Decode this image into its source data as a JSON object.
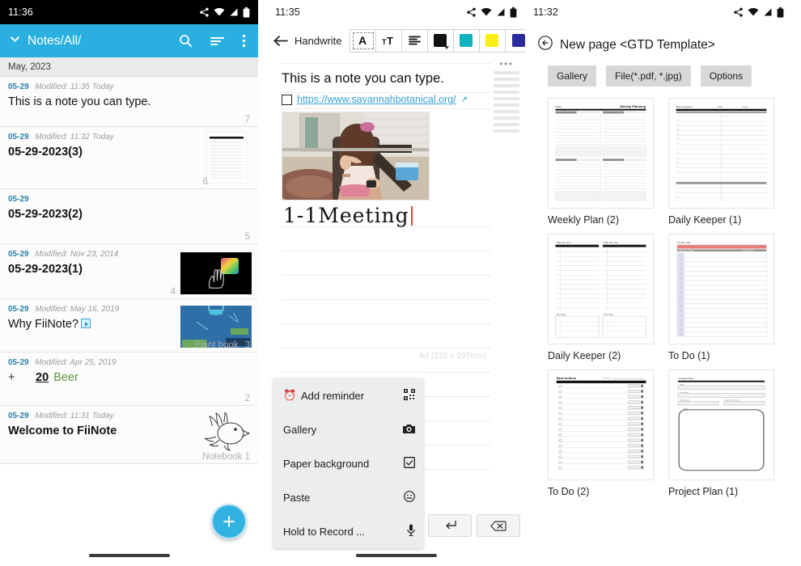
{
  "panel1": {
    "status": {
      "time": "11:36",
      "icons": [
        "share-icon",
        "wifi-icon",
        "signal-icon",
        "battery-icon"
      ]
    },
    "appbar": {
      "title": "Notes/All/",
      "chevron": "chevron-down-icon",
      "icons": [
        "search-icon",
        "sort-icon",
        "overflow-menu-icon"
      ]
    },
    "month_header": "May, 2023",
    "notes": [
      {
        "date": "05-29",
        "modified": "Modified: 11:35 Today",
        "title": "This is a note you can type.",
        "bold": false,
        "count": "7",
        "notebook": "",
        "thumb": "none"
      },
      {
        "date": "05-29",
        "modified": "Modified: 11:32 Today",
        "title": "05-29-2023(3)",
        "bold": true,
        "count": "6",
        "notebook": "",
        "thumb": "planner"
      },
      {
        "date": "05-29",
        "modified": "",
        "title": "05-29-2023(2)",
        "bold": true,
        "count": "5",
        "notebook": "",
        "thumb": "none"
      },
      {
        "date": "05-29",
        "modified": "Modified: Nov 23, 2014",
        "title": "05-29-2023(1)",
        "bold": true,
        "count": "4",
        "notebook": "",
        "thumb": "dark-hand"
      },
      {
        "date": "05-29",
        "modified": "Modified: May 16, 2019",
        "title": "Why FiiNote?",
        "bold": false,
        "count": "3",
        "notebook": "Paint book",
        "thumb": "blue-diagram",
        "badge": "video-icon"
      },
      {
        "date": "05-29",
        "modified": "Modified: Apr 25, 2019",
        "title": "",
        "bold": false,
        "count": "2",
        "notebook": "",
        "thumb": "none",
        "beer": {
          "plus": "+",
          "qty": "20",
          "name": "Beer"
        }
      },
      {
        "date": "05-29",
        "modified": "Modified: 11:31 Today",
        "title": "Welcome to FiiNote",
        "bold": true,
        "count": "",
        "notebook": "Notebook 1",
        "thumb": "bird"
      }
    ],
    "fab_label": "+"
  },
  "panel2": {
    "status": {
      "time": "11:35",
      "icons": [
        "share-icon",
        "wifi-icon",
        "signal-icon",
        "battery-icon"
      ]
    },
    "toolbar": {
      "back": "back-arrow-icon",
      "mode_label": "Handwrite",
      "buttons": [
        {
          "name": "text-style-button",
          "glyph": "A",
          "selected": true
        },
        {
          "name": "font-size-button",
          "glyph": "тT",
          "selected": false
        },
        {
          "name": "align-button",
          "glyph": "align-icon",
          "selected": false
        }
      ],
      "colors": [
        {
          "name": "color-black",
          "hex": "#111111",
          "has_caret": true
        },
        {
          "name": "color-teal",
          "hex": "#11b3c0",
          "has_caret": false
        },
        {
          "name": "color-yellow",
          "hex": "#ffee10",
          "has_caret": false
        },
        {
          "name": "color-navy",
          "hex": "#2b2b9e",
          "has_caret": false
        }
      ]
    },
    "note": {
      "heading": "This is a note you can type.",
      "link": "https://www.savannahbotanical.org/",
      "handwriting": "1-1Meeting",
      "paper_label": "A4 (210 × 297mm)"
    },
    "context_menu": [
      {
        "label": "Add reminder",
        "left_icon": "alarm-icon",
        "right_icon": "qr-code-icon"
      },
      {
        "label": "Gallery",
        "left_icon": "",
        "right_icon": "camera-icon"
      },
      {
        "label": "Paper background",
        "left_icon": "",
        "right_icon": "checkbox-icon"
      },
      {
        "label": "Paste",
        "left_icon": "",
        "right_icon": "emoji-icon"
      },
      {
        "label": "Hold to Record ...",
        "left_icon": "",
        "right_icon": "microphone-icon"
      }
    ],
    "keys": [
      {
        "name": "enter-key",
        "glyph": "enter-icon"
      },
      {
        "name": "backspace-key",
        "glyph": "backspace-icon"
      }
    ]
  },
  "panel3": {
    "status": {
      "time": "11:32",
      "icons": [
        "share-icon",
        "wifi-icon",
        "signal-icon",
        "battery-icon"
      ]
    },
    "title": "New page <GTD Template>",
    "back_icon": "back-circle-icon",
    "buttons": [
      {
        "name": "gallery-button",
        "label": "Gallery"
      },
      {
        "name": "file-button",
        "label": "File(*.pdf, *.jpg)"
      },
      {
        "name": "options-button",
        "label": "Options"
      }
    ],
    "templates": [
      {
        "label": "Weekly Plan (2)",
        "style": "weekly",
        "heading": "Weekly Planning"
      },
      {
        "label": "Daily Keeper (1)",
        "style": "daily1",
        "heading": "Day Keeper"
      },
      {
        "label": "Daily Keeper (2)",
        "style": "daily2",
        "heading": "Plan the time"
      },
      {
        "label": "To Do (1)",
        "style": "todo1",
        "heading": "To Do List"
      },
      {
        "label": "To Do (2)",
        "style": "todo2",
        "heading": "Next Actions"
      },
      {
        "label": "Project Plan (1)",
        "style": "project",
        "heading": "Project Plan"
      }
    ]
  },
  "colors": {
    "accent": "#29b0e0",
    "fab": "#31b2e2",
    "date": "#2a7fa8",
    "green": "#5f9a3c"
  }
}
